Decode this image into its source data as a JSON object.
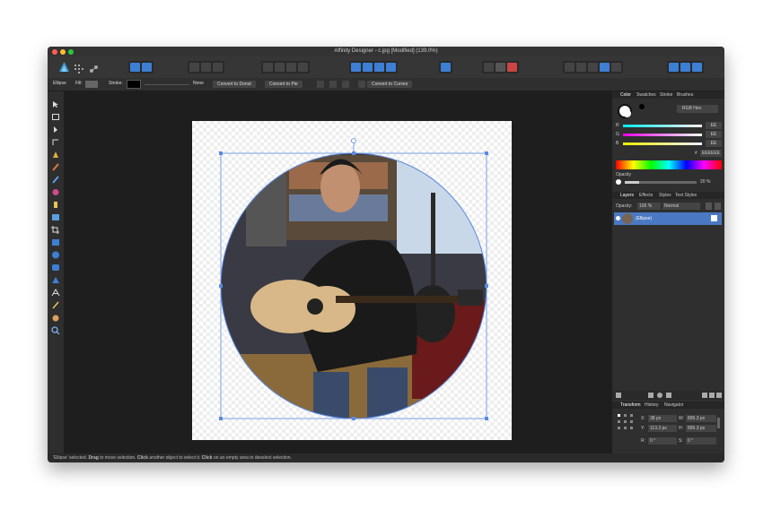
{
  "window": {
    "title": "Affinity Designer - c.jpg [Modified] (139.0%)"
  },
  "context_bar": {
    "shape_name": "Ellipse",
    "fill_label": "Fill:",
    "stroke_label": "Stroke:",
    "stroke_style": "None",
    "convert_donut": "Convert to Donut",
    "convert_pie": "Convert to Pie",
    "convert_curves": "Convert to Curves"
  },
  "color_panel": {
    "tabs": [
      "Color",
      "Swatches",
      "Stroke",
      "Brushes"
    ],
    "mode": "RGB Hex",
    "channels": [
      {
        "label": "R",
        "value": "EE"
      },
      {
        "label": "G",
        "value": "EE"
      },
      {
        "label": "B",
        "value": "EE"
      }
    ],
    "hex_label": "#",
    "hex": "EEEEEE",
    "opacity_label": "Opacity",
    "opacity_value": "20 %",
    "opacity_fraction": 0.2
  },
  "layers_panel": {
    "tabs": [
      "Layers",
      "Effects",
      "Styles",
      "Text Styles"
    ],
    "opacity_label": "Opacity:",
    "opacity_value": "100 %",
    "blend_mode": "Normal",
    "layer_name": "(Ellipse)"
  },
  "transform_panel": {
    "tabs": [
      "Transform",
      "History",
      "Navigator"
    ],
    "x_label": "X:",
    "x": "38 px",
    "y_label": "Y:",
    "y": "113.3 px",
    "w_label": "W:",
    "w": "895.3 px",
    "h_label": "H:",
    "h": "895.3 px",
    "r_label": "R:",
    "r": "0 °",
    "s_label": "S:",
    "s": "0 °"
  },
  "status": {
    "p1": "'Ellipse' selected. ",
    "drag": "Drag",
    "p2": " to move selection. ",
    "click1": "Click",
    "p3": " another object to select it. ",
    "click2": "Click",
    "p4": " on an empty area to deselect selection."
  },
  "colors": {
    "accent": "#3d7fd4",
    "layer_selected": "#4a78c2"
  }
}
